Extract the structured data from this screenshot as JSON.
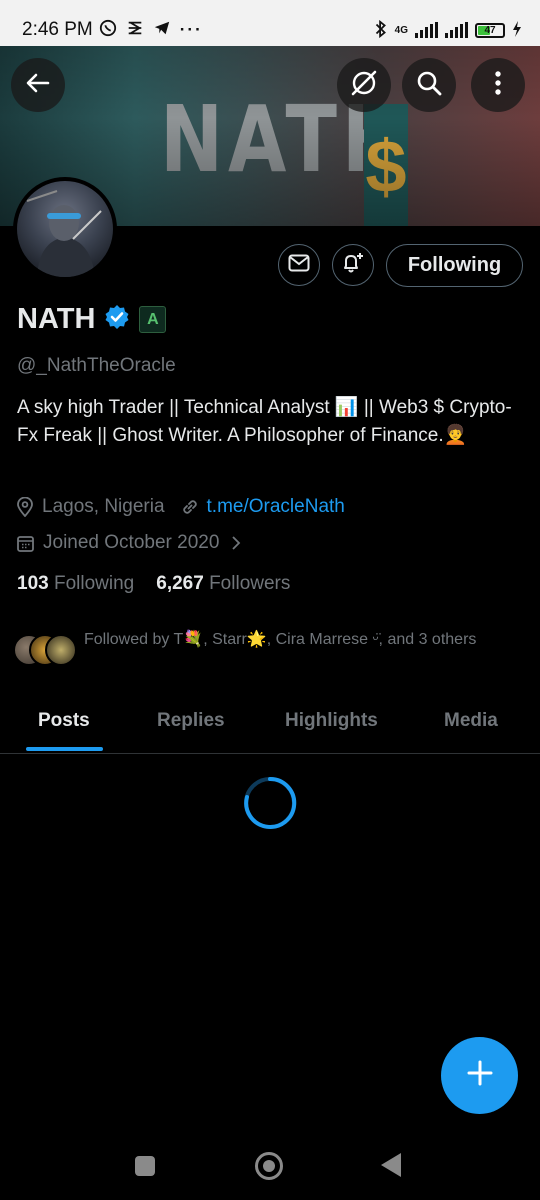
{
  "status_bar": {
    "time": "2:46 PM",
    "network": "4G",
    "battery": "47",
    "app_icons": [
      "whatsapp-icon",
      "link-icon",
      "telegram-icon",
      "more-dots-icon"
    ]
  },
  "banner": {
    "title": "NATH",
    "symbol": "$"
  },
  "profile": {
    "name": "NATH",
    "handle": "@_NathTheOracle",
    "affiliate_badge": "A",
    "bio": "A sky high Trader || Technical Analyst 📊 || Web3 $ Crypto-Fx Freak || Ghost Writer. A Philosopher of Finance.🧑‍🦱",
    "location": "Lagos, Nigeria",
    "website": "t.me/OracleNath",
    "joined": "Joined October 2020",
    "following_count": "103",
    "following_label": "Following",
    "followers_count": "6,267",
    "followers_label": "Followers",
    "followed_by": "Followed by T💐, Starr🌟, Cira Marrese ᵕ̈, and 3 others",
    "follow_button": "Following"
  },
  "tabs": [
    {
      "label": "Posts",
      "active": true
    },
    {
      "label": "Replies",
      "active": false
    },
    {
      "label": "Highlights",
      "active": false
    },
    {
      "label": "Media",
      "active": false
    }
  ],
  "colors": {
    "accent": "#1d9bf0",
    "background": "#000000",
    "muted_text": "#71767b",
    "verified": "#1d9bf0"
  }
}
